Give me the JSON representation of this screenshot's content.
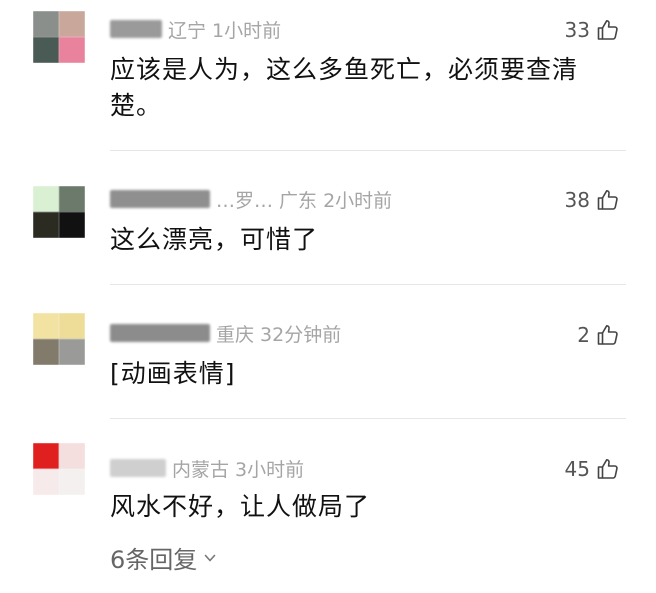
{
  "comments": [
    {
      "meta_text": "辽宁 1小时前",
      "likes": "33",
      "text": "应该是人为，这么多鱼死亡，必须要查清楚。",
      "avatar_colors": [
        "#8a8f8c",
        "#c9a79b",
        "#4a5a55",
        "#e9829c"
      ],
      "nick_blur_color": "#9a9a9a"
    },
    {
      "meta_text": "…罗… 广东 2小时前",
      "likes": "38",
      "text": "这么漂亮，可惜了",
      "avatar_colors": [
        "#d9f0d3",
        "#6b7a6b",
        "#2b2b22",
        "#111111"
      ],
      "nick_blur_color": "#8f8f8f"
    },
    {
      "meta_text": "重庆 32分钟前",
      "likes": "2",
      "text": "[动画表情]",
      "avatar_colors": [
        "#f3e3a3",
        "#eedd99",
        "#827a6a",
        "#9a9b99"
      ],
      "nick_blur_color": "#8c8c8c"
    },
    {
      "meta_text": "内蒙古 3小时前",
      "likes": "45",
      "text": "风水不好，让人做局了",
      "avatar_colors": [
        "#e0201f",
        "#f4dede",
        "#f6eaea",
        "#f4f0f0"
      ],
      "nick_blur_color": "#cfcfcf"
    }
  ],
  "replies_label": "6条回复",
  "icons": {
    "like": "thumbs-up-icon",
    "expand": "chevron-down-icon"
  }
}
